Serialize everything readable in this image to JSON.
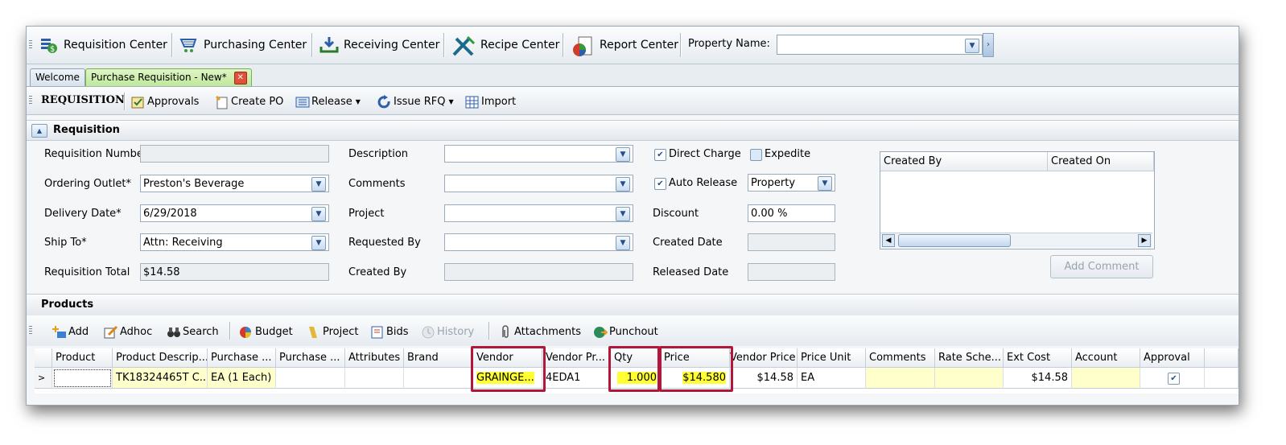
{
  "nav": {
    "requisition_center": "Requisition Center",
    "purchasing_center": "Purchasing Center",
    "receiving_center": "Receiving Center",
    "recipe_center": "Recipe Center",
    "report_center": "Report Center",
    "property_label": "Property Name:",
    "property_value": ""
  },
  "tabs": [
    {
      "label": "Welcome"
    },
    {
      "label": "Purchase Requisition - New*"
    }
  ],
  "toolbar": {
    "title": "REQUISITION",
    "approvals": "Approvals",
    "create_po": "Create PO",
    "release": "Release",
    "issue_rfq": "Issue RFQ",
    "import": "Import"
  },
  "requisition": {
    "section_title": "Requisition",
    "req_number_label": "Requisition Number",
    "req_number": "",
    "ordering_outlet_label": "Ordering Outlet*",
    "ordering_outlet": "Preston's Beverage",
    "delivery_date_label": "Delivery Date*",
    "delivery_date": "6/29/2018",
    "ship_to_label": "Ship To*",
    "ship_to": "Attn: Receiving",
    "req_total_label": "Requisition Total",
    "req_total": "$14.58",
    "description_label": "Description",
    "comments_label": "Comments",
    "project_label": "Project",
    "requested_by_label": "Requested By",
    "created_by_label": "Created By",
    "direct_charge_label": "Direct Charge",
    "direct_charge": true,
    "expedite_label": "Expedite",
    "expedite": false,
    "auto_release_label": "Auto Release",
    "auto_release": true,
    "auto_release_value": "Property",
    "discount_label": "Discount",
    "discount": "0.00 %",
    "created_date_label": "Created Date",
    "released_date_label": "Released Date",
    "comment_grid": {
      "col1": "Created By",
      "col2": "Created On"
    },
    "add_comment": "Add Comment"
  },
  "products": {
    "section_title": "Products",
    "toolbar": {
      "add": "Add",
      "adhoc": "Adhoc",
      "search": "Search",
      "budget": "Budget",
      "project": "Project",
      "bids": "Bids",
      "history": "History",
      "attachments": "Attachments",
      "punchout": "Punchout"
    },
    "columns": [
      "Product",
      "Product Descrip...",
      "Purchase ...",
      "Purchase ...",
      "Attributes",
      "Brand",
      "Vendor",
      "Vendor Pr...",
      "Qty",
      "Price",
      "Vendor Price",
      "Price Unit",
      "Comments",
      "Rate Sche...",
      "Ext Cost",
      "Account",
      "Approval"
    ],
    "row": {
      "product": "",
      "description": "TK18324465T C...",
      "purchase_unit": "EA (1 Each)",
      "purchase2": "",
      "attributes": "",
      "brand": "",
      "vendor": "GRAINGE...",
      "vendor_product": "4EDA1",
      "qty": "1.000",
      "price": "$14.580",
      "vendor_price": "$14.58",
      "price_unit": "EA",
      "comments": "",
      "rate_schedule": "",
      "ext_cost": "$14.58",
      "account": "",
      "approval": true
    }
  },
  "colors": {
    "highlight_box": "#b0173a",
    "yellow_cell": "#ffff33"
  }
}
